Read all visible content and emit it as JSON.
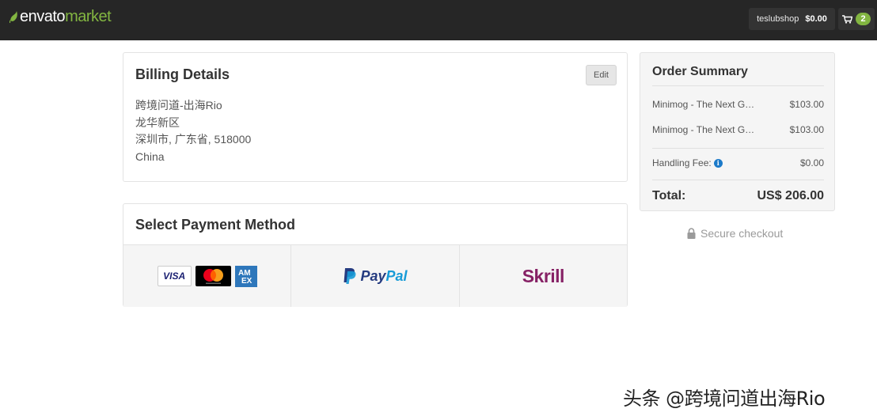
{
  "header": {
    "logo_part1": "envato",
    "logo_part2": "market",
    "username": "teslubshop",
    "balance": "$0.00",
    "cart_count": "2",
    "cart_icon": "shopping-cart-icon",
    "brand_green": "#82b541"
  },
  "billing": {
    "title": "Billing Details",
    "edit_label": "Edit",
    "address_lines": [
      "跨境问道-出海Rio",
      "龙华新区",
      "深圳市, 广东省, 518000",
      "China"
    ]
  },
  "payment": {
    "title": "Select Payment Method",
    "methods": [
      {
        "name": "cards",
        "card_brands": [
          "VISA",
          "Mastercard",
          "AMEX"
        ]
      },
      {
        "name": "paypal",
        "label_pay": "Pay",
        "label_pal": "Pal"
      },
      {
        "name": "skrill",
        "label": "Skrill"
      }
    ]
  },
  "summary": {
    "title": "Order Summary",
    "items": [
      {
        "name": "Minimog - The Next Gene...",
        "price": "$103.00"
      },
      {
        "name": "Minimog - The Next Gene...",
        "price": "$103.00"
      }
    ],
    "handling_label": "Handling Fee:",
    "handling_value": "$0.00",
    "total_label": "Total:",
    "total_value": "US$ 206.00"
  },
  "secure": {
    "label": "Secure checkout",
    "icon": "lock-icon"
  },
  "watermark": {
    "text": "头条 @跨境问道出海Rio"
  }
}
